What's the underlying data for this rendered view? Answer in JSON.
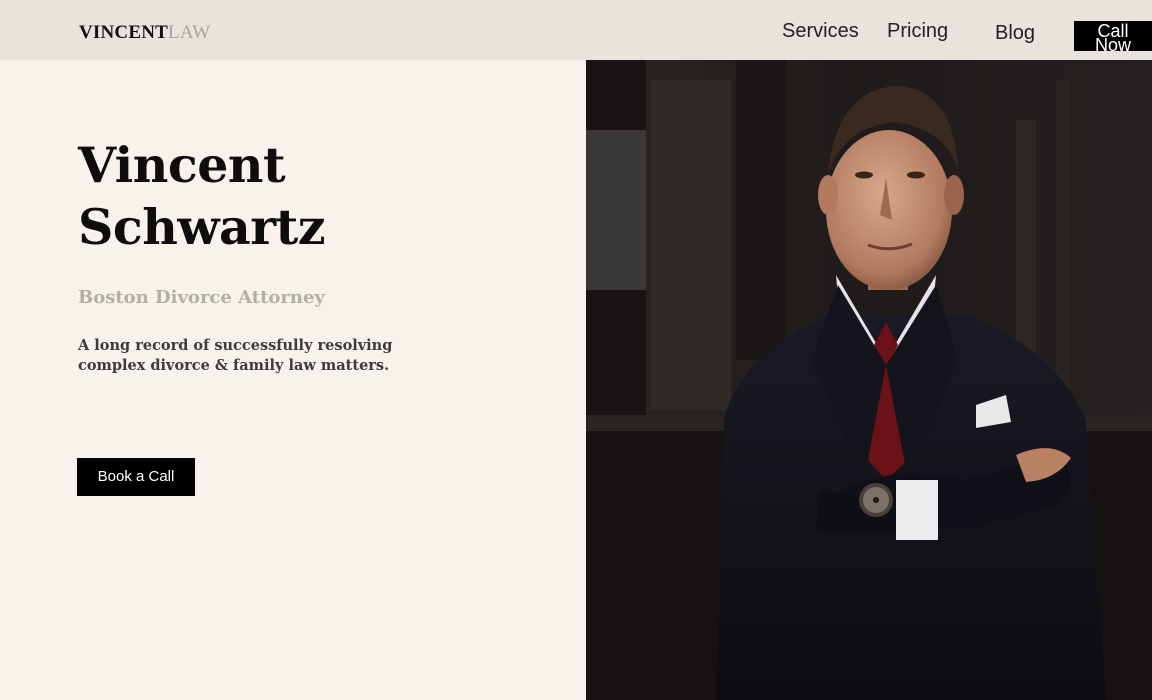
{
  "header": {
    "logo_strong": "VINCENT",
    "logo_light": "LAW",
    "nav": {
      "services": "Services",
      "pricing": "Pricing",
      "blog": "Blog"
    },
    "cta_line1": "Call",
    "cta_line2": "Now"
  },
  "hero": {
    "title_line1": "Vincent",
    "title_line2": "Schwartz",
    "subtitle": "Boston Divorce Attorney",
    "description_line1": "A long record of successfully resolving",
    "description_line2": "complex divorce & family law matters.",
    "button_label": "Book a Call"
  },
  "colors": {
    "page_background": "#f7f2ec",
    "header_background": "#e7e3dd",
    "button_background": "#000000",
    "subtitle_color": "#b4aea6"
  }
}
